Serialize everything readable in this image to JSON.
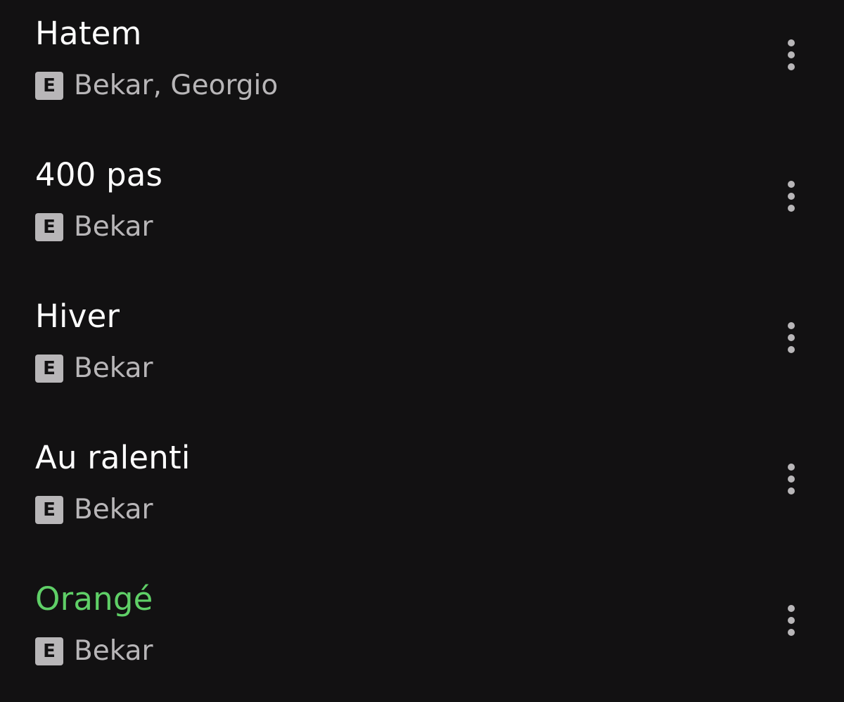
{
  "colors": {
    "background": "#121112",
    "title": "#ffffff",
    "active_title": "#5fcf67",
    "artist": "#b8b6b8",
    "badge_bg": "#b8b6b8",
    "badge_text": "#121112",
    "more_icon": "#b8b6b8"
  },
  "icons": {
    "explicit": "explicit-badge-icon",
    "more": "more-options-vertical-icon"
  },
  "tracks": [
    {
      "title": "Hatem",
      "explicit": "E",
      "artists": "Bekar, Georgio",
      "active": false
    },
    {
      "title": "400 pas",
      "explicit": "E",
      "artists": "Bekar",
      "active": false
    },
    {
      "title": "Hiver",
      "explicit": "E",
      "artists": "Bekar",
      "active": false
    },
    {
      "title": "Au ralenti",
      "explicit": "E",
      "artists": "Bekar",
      "active": false
    },
    {
      "title": "Orangé",
      "explicit": "E",
      "artists": "Bekar",
      "active": true
    }
  ]
}
